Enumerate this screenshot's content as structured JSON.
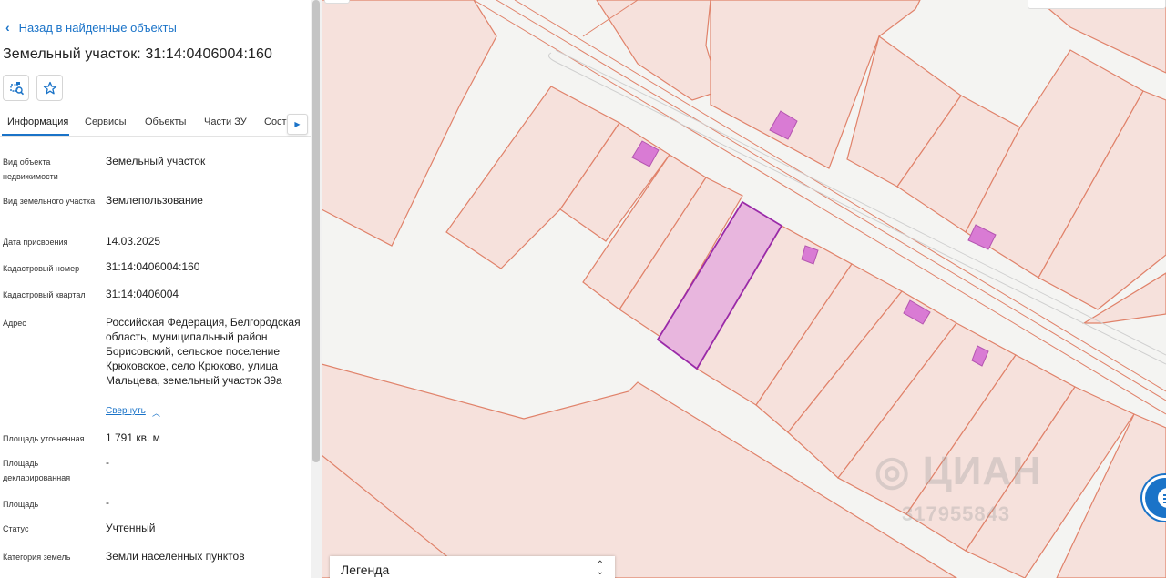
{
  "panel": {
    "back_label": "Назад в найденные объекты",
    "title": "Земельный участок: 31:14:0406004:160",
    "tools": [
      {
        "icon": "parcel-search-icon"
      },
      {
        "icon": "star-icon"
      }
    ],
    "tabs": [
      "Информация",
      "Сервисы",
      "Объекты",
      "Части ЗУ",
      "Состав"
    ],
    "active_tab": "Информация",
    "fields": {
      "object_type": {
        "label": "Вид объекта недвижимости",
        "value": "Земельный участок"
      },
      "land_type": {
        "label": "Вид земельного участка",
        "value": "Землепользование"
      },
      "assigned_date": {
        "label": "Дата присвоения",
        "value": "14.03.2025"
      },
      "cadastral_number": {
        "label": "Кадастровый номер",
        "value": "31:14:0406004:160"
      },
      "cadastral_quarter": {
        "label": "Кадастровый квартал",
        "value": "31:14:0406004"
      },
      "address": {
        "label": "Адрес",
        "value": "Российская Федерация, Белгородская область, муниципальный район Борисовский, сельское поселение Крюковское, село Крюково, улица Мальцева, земельный участок 39а"
      },
      "collapse_label": "Свернуть",
      "area_refined": {
        "label": "Площадь уточненная",
        "value": "1 791 кв. м"
      },
      "area_declared": {
        "label": "Площадь декларированная",
        "value": "-"
      },
      "area": {
        "label": "Площадь",
        "value": "-"
      },
      "status": {
        "label": "Статус",
        "value": "Учтенный"
      },
      "land_category": {
        "label": "Категория земель",
        "value": "Земли населенных пунктов"
      }
    }
  },
  "map": {
    "legend_label": "Легенда",
    "parcel_stroke": "#e0826a",
    "parcel_fill": "#f6e1dc",
    "building_fill": "#d97bd4",
    "selected_stroke": "#9a2aa8",
    "selected_fill": "#e8b6de",
    "watermark": "ЦИАН",
    "watermark_id": "317955843"
  },
  "colors": {
    "accent": "#1a73c8"
  }
}
